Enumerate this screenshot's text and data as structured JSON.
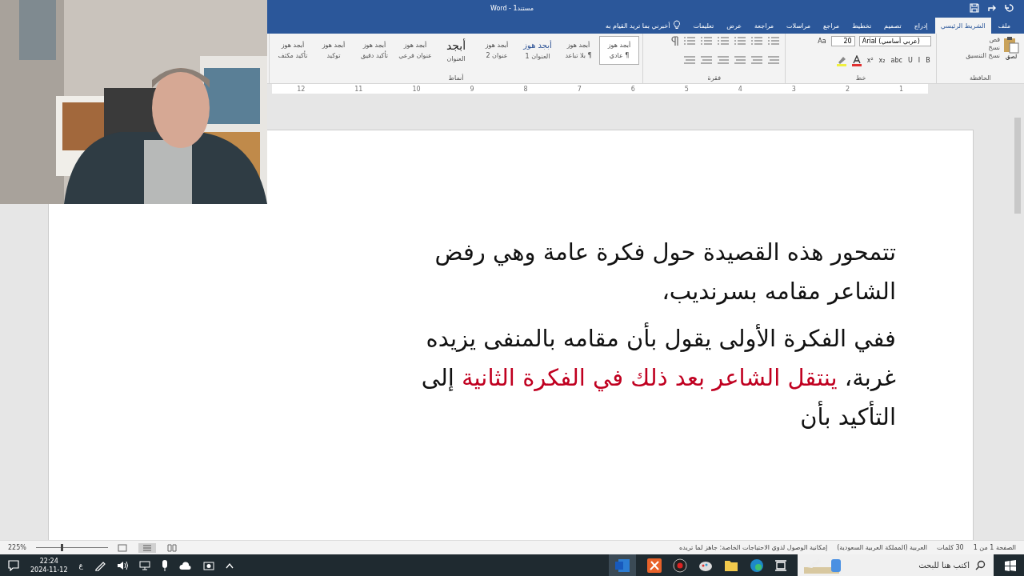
{
  "window": {
    "title": "مستند1 - Word"
  },
  "tabs": [
    {
      "label": "ملف",
      "selected": false
    },
    {
      "label": "الشريط الرئيسي",
      "selected": true
    },
    {
      "label": "إدراج",
      "selected": false
    },
    {
      "label": "تصميم",
      "selected": false
    },
    {
      "label": "تخطيط",
      "selected": false
    },
    {
      "label": "مراجع",
      "selected": false
    },
    {
      "label": "مراسلات",
      "selected": false
    },
    {
      "label": "مراجعة",
      "selected": false
    },
    {
      "label": "عرض",
      "selected": false
    },
    {
      "label": "تعليمات",
      "selected": false
    }
  ],
  "tell_me": "أخبرني بما تريد القيام به",
  "clipboard": {
    "label": "الحافظة",
    "paste": "لصق",
    "cut": "قص",
    "copy": "نسخ",
    "format_painter": "نسخ التنسيق"
  },
  "font": {
    "label": "خط",
    "name": "Arial (عربي أساسي)",
    "size": "20",
    "change_case": "Aa",
    "format_buttons": [
      "B",
      "I",
      "U",
      "abc",
      "x₂",
      "x²"
    ]
  },
  "paragraph": {
    "label": "فقرة"
  },
  "styles": {
    "label": "أنماط",
    "items": [
      {
        "preview": "أبجد هوز",
        "name": "¶ عادي",
        "kind": "small",
        "selected": true
      },
      {
        "preview": "أبجد هوز",
        "name": "¶ بلا تباعد",
        "kind": "small",
        "selected": false
      },
      {
        "preview": "أبجد هوز",
        "name": "العنوان 1",
        "kind": "heading",
        "selected": false
      },
      {
        "preview": "أبجد هوز",
        "name": "عنوان 2",
        "kind": "small",
        "selected": false
      },
      {
        "preview": "أبجد",
        "name": "العنوان",
        "kind": "title",
        "selected": false
      },
      {
        "preview": "أبجد هوز",
        "name": "عنوان فرعي",
        "kind": "small",
        "selected": false
      },
      {
        "preview": "أبجد هوز",
        "name": "تأكيد دقيق",
        "kind": "small",
        "selected": false
      },
      {
        "preview": "أبجد هوز",
        "name": "توكيد",
        "kind": "small",
        "selected": false
      },
      {
        "preview": "أبجد هوز",
        "name": "تأكيد مكثف",
        "kind": "small",
        "selected": false
      }
    ]
  },
  "ruler": [
    "1",
    "2",
    "3",
    "4",
    "5",
    "6",
    "7",
    "8",
    "9",
    "10",
    "11",
    "12"
  ],
  "document": {
    "paragraphs": [
      [
        {
          "text": "تتمحور هذه القصيدة حول فكرة عامة وهي رفض الشاعر مقامه بسرنديب،",
          "emphasis": false
        }
      ],
      [
        {
          "text": "ففي الفكرة الأولى يقول بأن مقامه بالمنفى يزيده غربة، ",
          "emphasis": false
        },
        {
          "text": "ينتقل الشاعر بعد ذلك في الفكرة الثانية",
          "emphasis": true
        },
        {
          "text": " إلى التأكيد بأن",
          "emphasis": false
        }
      ]
    ]
  },
  "status_bar": {
    "page": "الصفحة 1 من 1",
    "words": "30 كلمات",
    "language": "العربية (المملكة العربية السعودية)",
    "accessibility": "إمكانية الوصول لذوي الاحتياجات الخاصة: جاهز لما تريده",
    "zoom": "225%",
    "zoom_slider": {
      "level": 0.35
    }
  },
  "taskbar": {
    "search": {
      "placeholder": "اكتب هنا للبحث"
    },
    "time": "22:24",
    "date": "2024-11-12",
    "input_language": "ع"
  }
}
